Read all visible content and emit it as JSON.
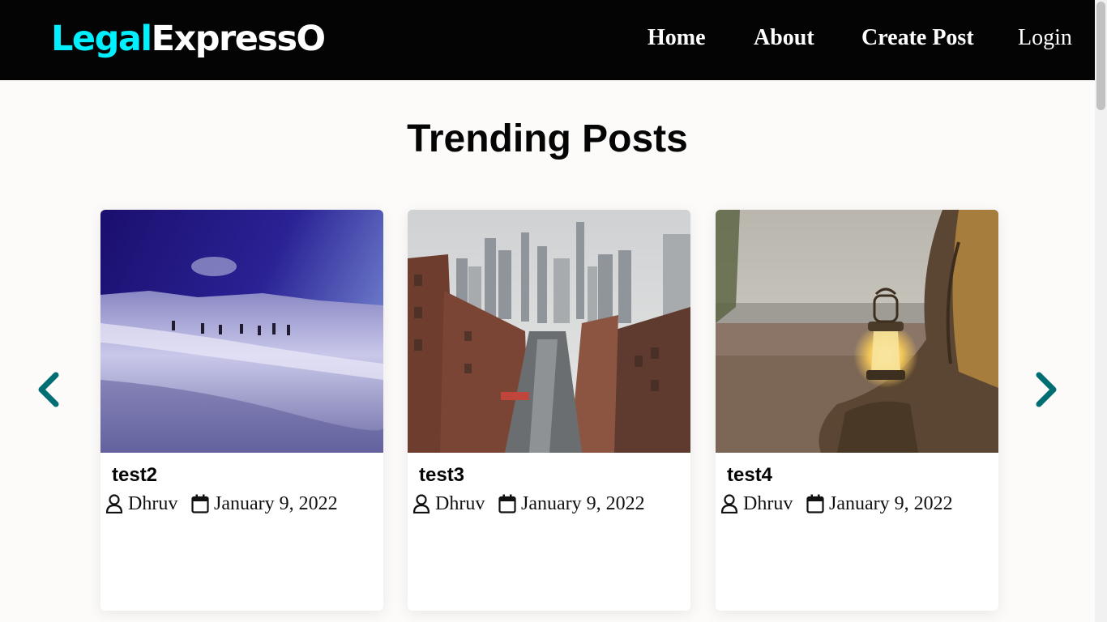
{
  "header": {
    "logo_part1": "Legal",
    "logo_part2": "ExpressO",
    "nav": [
      "Home",
      "About",
      "Create Post",
      "Login"
    ],
    "logo_accent_color": "#00f0ff",
    "background_color": "#040404"
  },
  "main": {
    "heading": "Trending Posts",
    "carousel": {
      "prev_icon": "chevron-left-icon",
      "next_icon": "chevron-right-icon",
      "arrow_color": "#006e73"
    },
    "posts": [
      {
        "title": "test2",
        "author": "Dhruv",
        "date": "January 9, 2022",
        "image": "snowy-mountain-hikers"
      },
      {
        "title": "test3",
        "author": "Dhruv",
        "date": "January 9, 2022",
        "image": "city-street-skyline"
      },
      {
        "title": "test4",
        "author": "Dhruv",
        "date": "January 9, 2022",
        "image": "lantern-on-tree-by-lake"
      }
    ],
    "meta_icons": [
      "user-icon",
      "calendar-icon"
    ]
  }
}
